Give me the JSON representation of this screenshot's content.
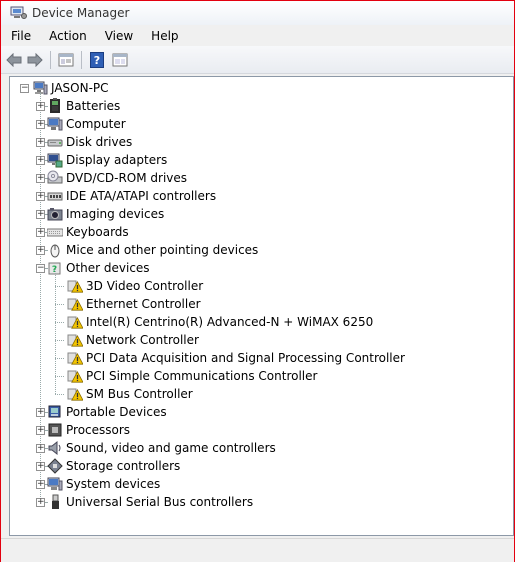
{
  "window": {
    "title": "Device Manager"
  },
  "menu": [
    "File",
    "Action",
    "View",
    "Help"
  ],
  "toolbar": {
    "buttons": [
      "back-icon",
      "forward-icon",
      "properties-icon",
      "help-icon",
      "view-icon"
    ]
  },
  "tree": {
    "root": "JASON-PC",
    "categories": [
      {
        "label": "Batteries",
        "icon": "battery-icon",
        "expanded": false
      },
      {
        "label": "Computer",
        "icon": "computer-icon",
        "expanded": false
      },
      {
        "label": "Disk drives",
        "icon": "disk-icon",
        "expanded": false
      },
      {
        "label": "Display adapters",
        "icon": "display-icon",
        "expanded": false
      },
      {
        "label": "DVD/CD-ROM drives",
        "icon": "dvd-icon",
        "expanded": false
      },
      {
        "label": "IDE ATA/ATAPI controllers",
        "icon": "ide-icon",
        "expanded": false
      },
      {
        "label": "Imaging devices",
        "icon": "camera-icon",
        "expanded": false
      },
      {
        "label": "Keyboards",
        "icon": "keyboard-icon",
        "expanded": false
      },
      {
        "label": "Mice and other pointing devices",
        "icon": "mouse-icon",
        "expanded": false
      },
      {
        "label": "Other devices",
        "icon": "unknown-device-icon",
        "expanded": true,
        "children": [
          "3D Video Controller",
          "Ethernet Controller",
          "Intel(R) Centrino(R) Advanced-N + WiMAX 6250",
          "Network Controller",
          "PCI Data Acquisition and Signal Processing Controller",
          "PCI Simple Communications Controller",
          "SM Bus Controller"
        ]
      },
      {
        "label": "Portable Devices",
        "icon": "portable-icon",
        "expanded": false
      },
      {
        "label": "Processors",
        "icon": "processor-icon",
        "expanded": false
      },
      {
        "label": "Sound, video and game controllers",
        "icon": "speaker-icon",
        "expanded": false
      },
      {
        "label": "Storage controllers",
        "icon": "storage-icon",
        "expanded": false
      },
      {
        "label": "System devices",
        "icon": "system-icon",
        "expanded": false
      },
      {
        "label": "Universal Serial Bus controllers",
        "icon": "usb-icon",
        "expanded": false
      }
    ]
  },
  "colors": {
    "window_border": "#e3000f",
    "warning": "#f2c400"
  }
}
